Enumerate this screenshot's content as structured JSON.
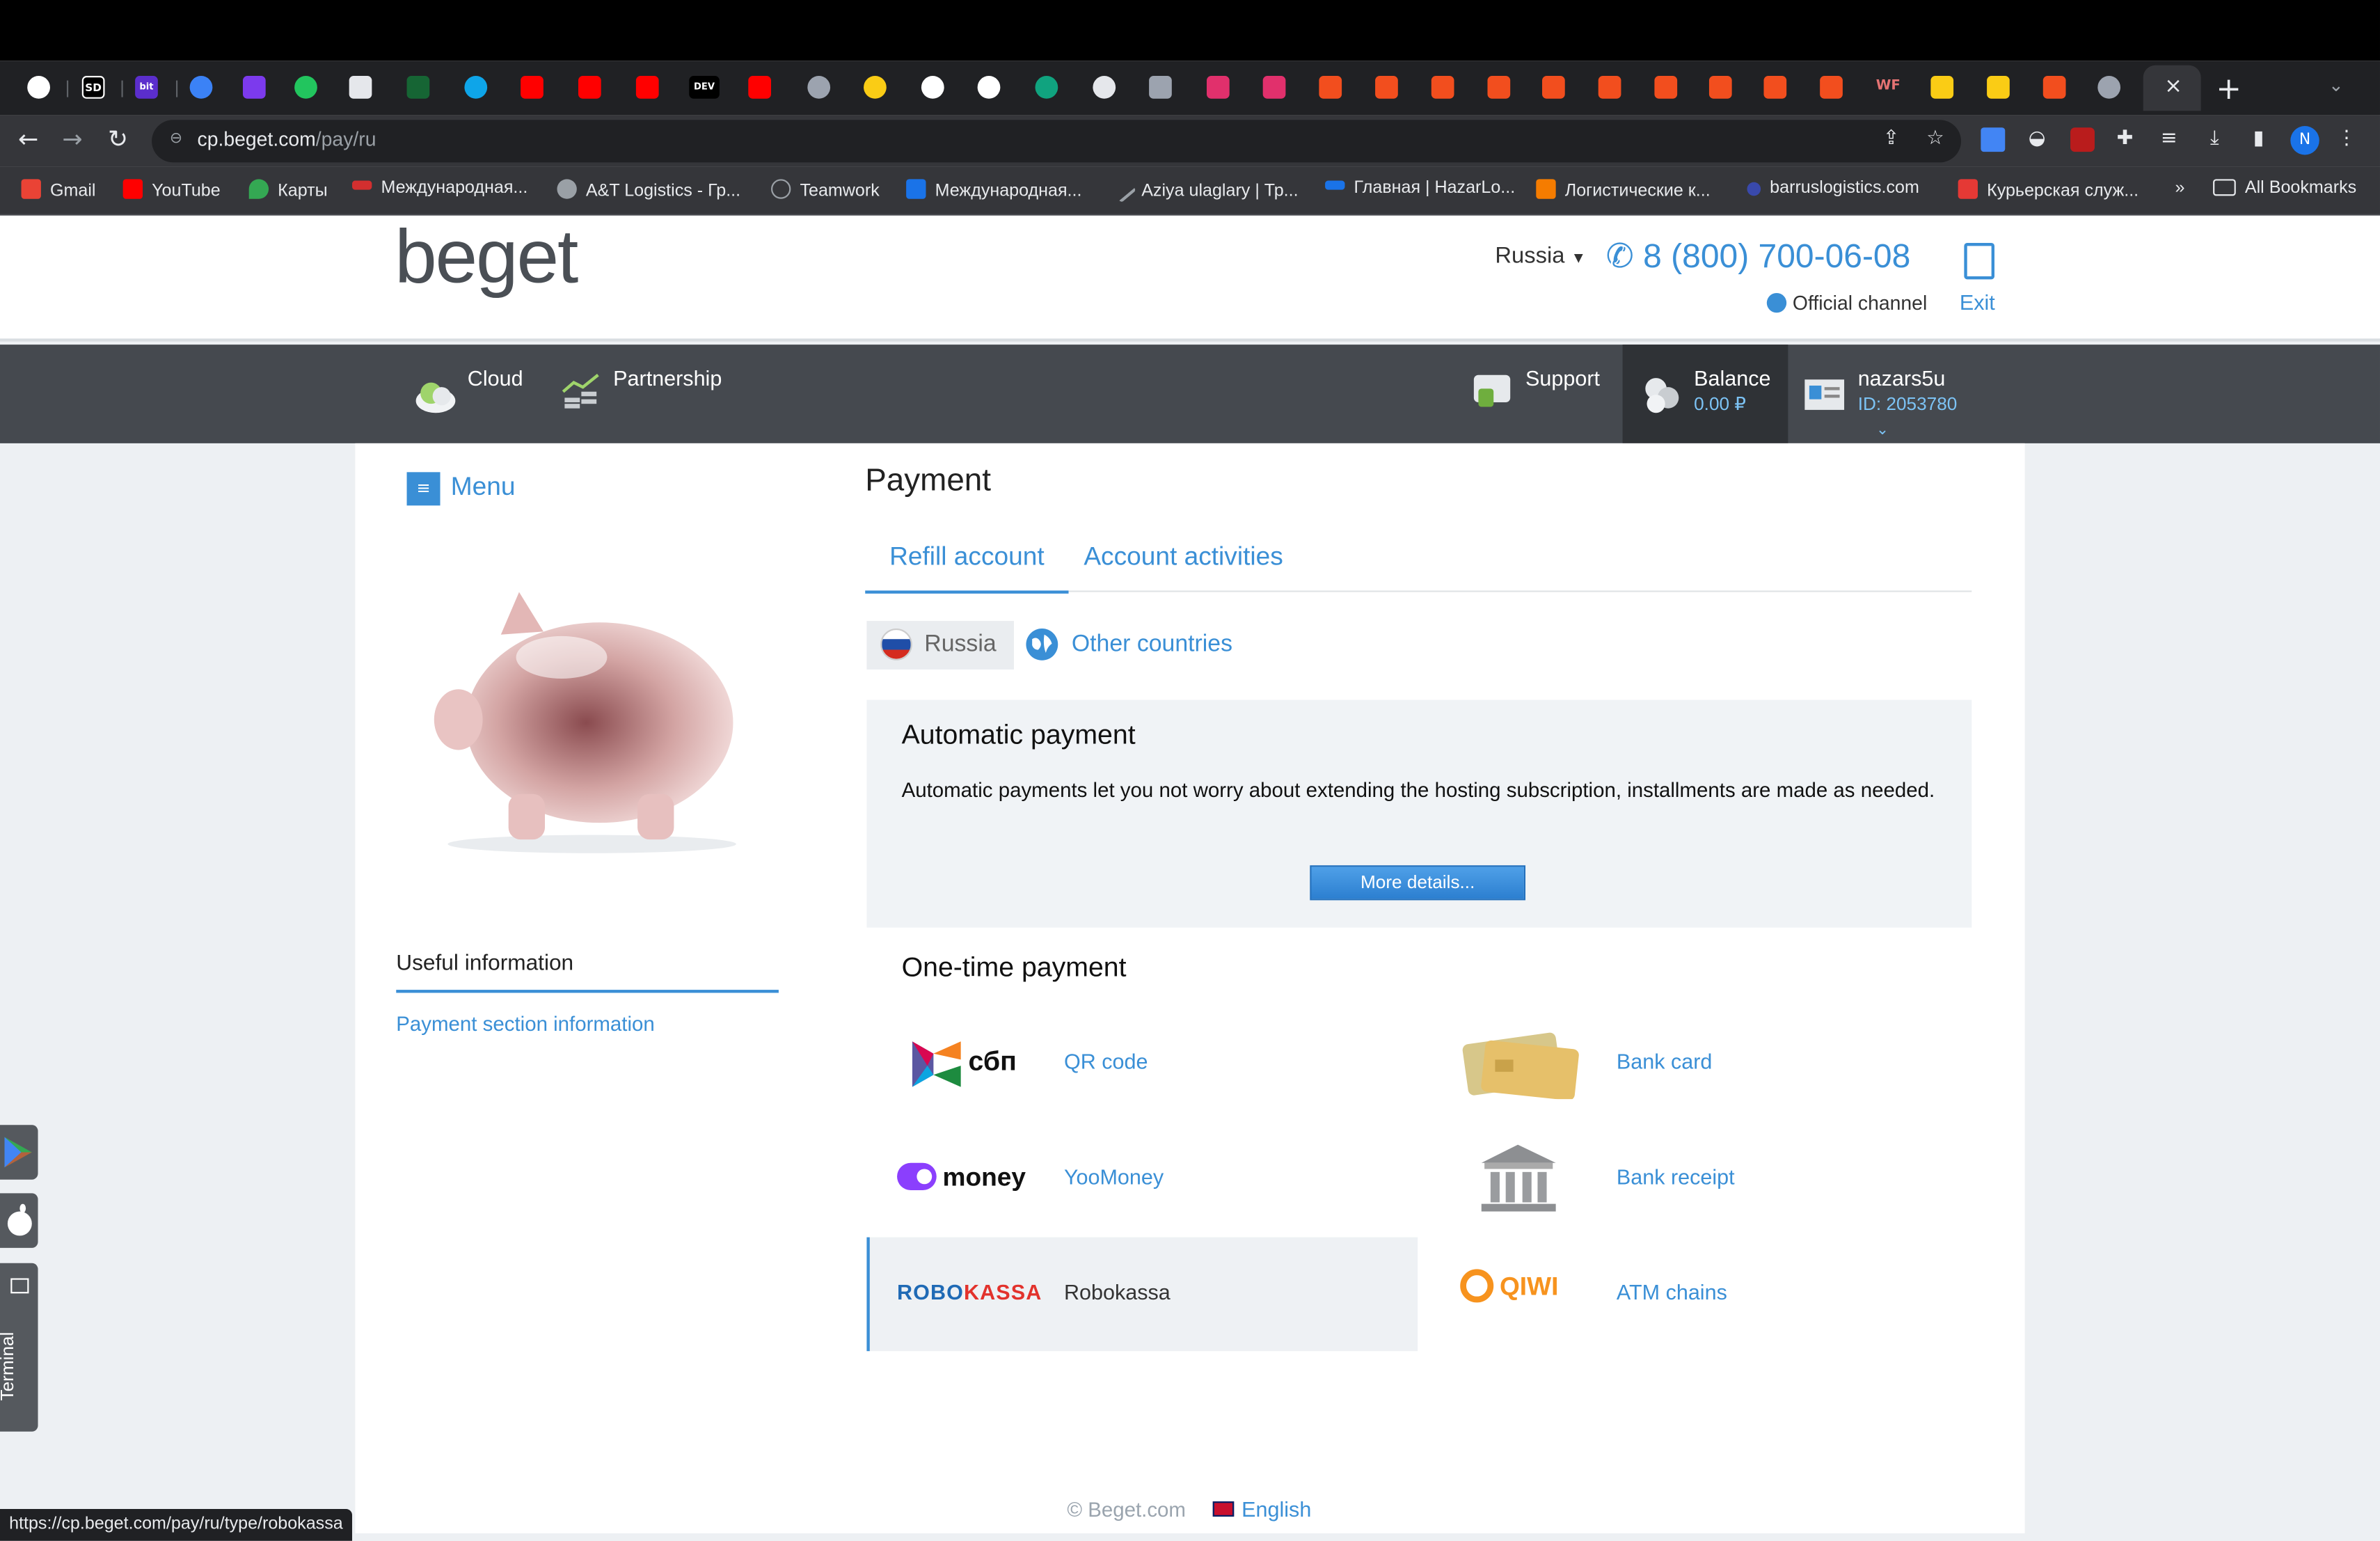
{
  "browser": {
    "address_host": "cp.beget.com",
    "address_path": "/pay/ru",
    "profile_initial": "N",
    "tab_close": "×",
    "new_tab": "+",
    "status_url": "https://cp.beget.com/pay/ru/type/robokassa",
    "tab_labels": [
      "SD",
      "bit",
      "DEV",
      "WF"
    ],
    "bookmarks": [
      {
        "label": "Gmail",
        "color": "#ea4335"
      },
      {
        "label": "YouTube",
        "color": "#ff0000"
      },
      {
        "label": "Карты",
        "color": "#34a853"
      },
      {
        "label": "Международная...",
        "color": "#d32f2f"
      },
      {
        "label": "A&T Logistics - Гр...",
        "color": "#9aa0a6"
      },
      {
        "label": "Teamwork",
        "color": "#9aa0a6"
      },
      {
        "label": "Международная...",
        "color": "#1a73e8"
      },
      {
        "label": "Aziya ulaglary | Тр...",
        "color": "#9aa0a6"
      },
      {
        "label": "Главная | HazarLo...",
        "color": "#1a73e8"
      },
      {
        "label": "Логистические к...",
        "color": "#f57c00"
      },
      {
        "label": "barruslogistics.com",
        "color": "#3949ab"
      },
      {
        "label": "Курьерская служ...",
        "color": "#e53935"
      }
    ],
    "bookmarks_overflow": "»",
    "all_bookmarks": "All Bookmarks"
  },
  "header": {
    "logo": "beget",
    "region": "Russia",
    "phone": "8 (800) 700-06-08",
    "channel": "Official channel",
    "exit": "Exit"
  },
  "nav": {
    "cloud": "Cloud",
    "partnership": "Partnership",
    "support": "Support",
    "balance_label": "Balance",
    "balance_value": "0.00 ₽",
    "username": "nazars5u",
    "user_id": "ID: 2053780"
  },
  "sidebar": {
    "menu": "Menu",
    "useful_heading": "Useful information",
    "useful_link": "Payment section information"
  },
  "main": {
    "title": "Payment",
    "tabs": [
      {
        "label": "Refill account"
      },
      {
        "label": "Account activities"
      }
    ],
    "country_russia": "Russia",
    "country_other": "Other countries",
    "auto_title": "Automatic payment",
    "auto_text": "Automatic payments let you not worry about extending the hosting subscription, installments are made as needed.",
    "auto_button": "More details...",
    "onetime_title": "One-time payment",
    "methods": {
      "sbp_logo": "сбп",
      "sbp": "QR code",
      "card": "Bank card",
      "yoomoney_logo": "money",
      "yoomoney": "YooMoney",
      "bank_receipt": "Bank receipt",
      "robo_logo_a": "ROBO",
      "robo_logo_b": "KASSA",
      "robokassa": "Robokassa",
      "qiwi_logo": "QIWI",
      "atm": "ATM chains"
    }
  },
  "footer": {
    "copyright": "© Beget.com",
    "language": "English"
  },
  "dock": {
    "terminal": "Terminal"
  }
}
